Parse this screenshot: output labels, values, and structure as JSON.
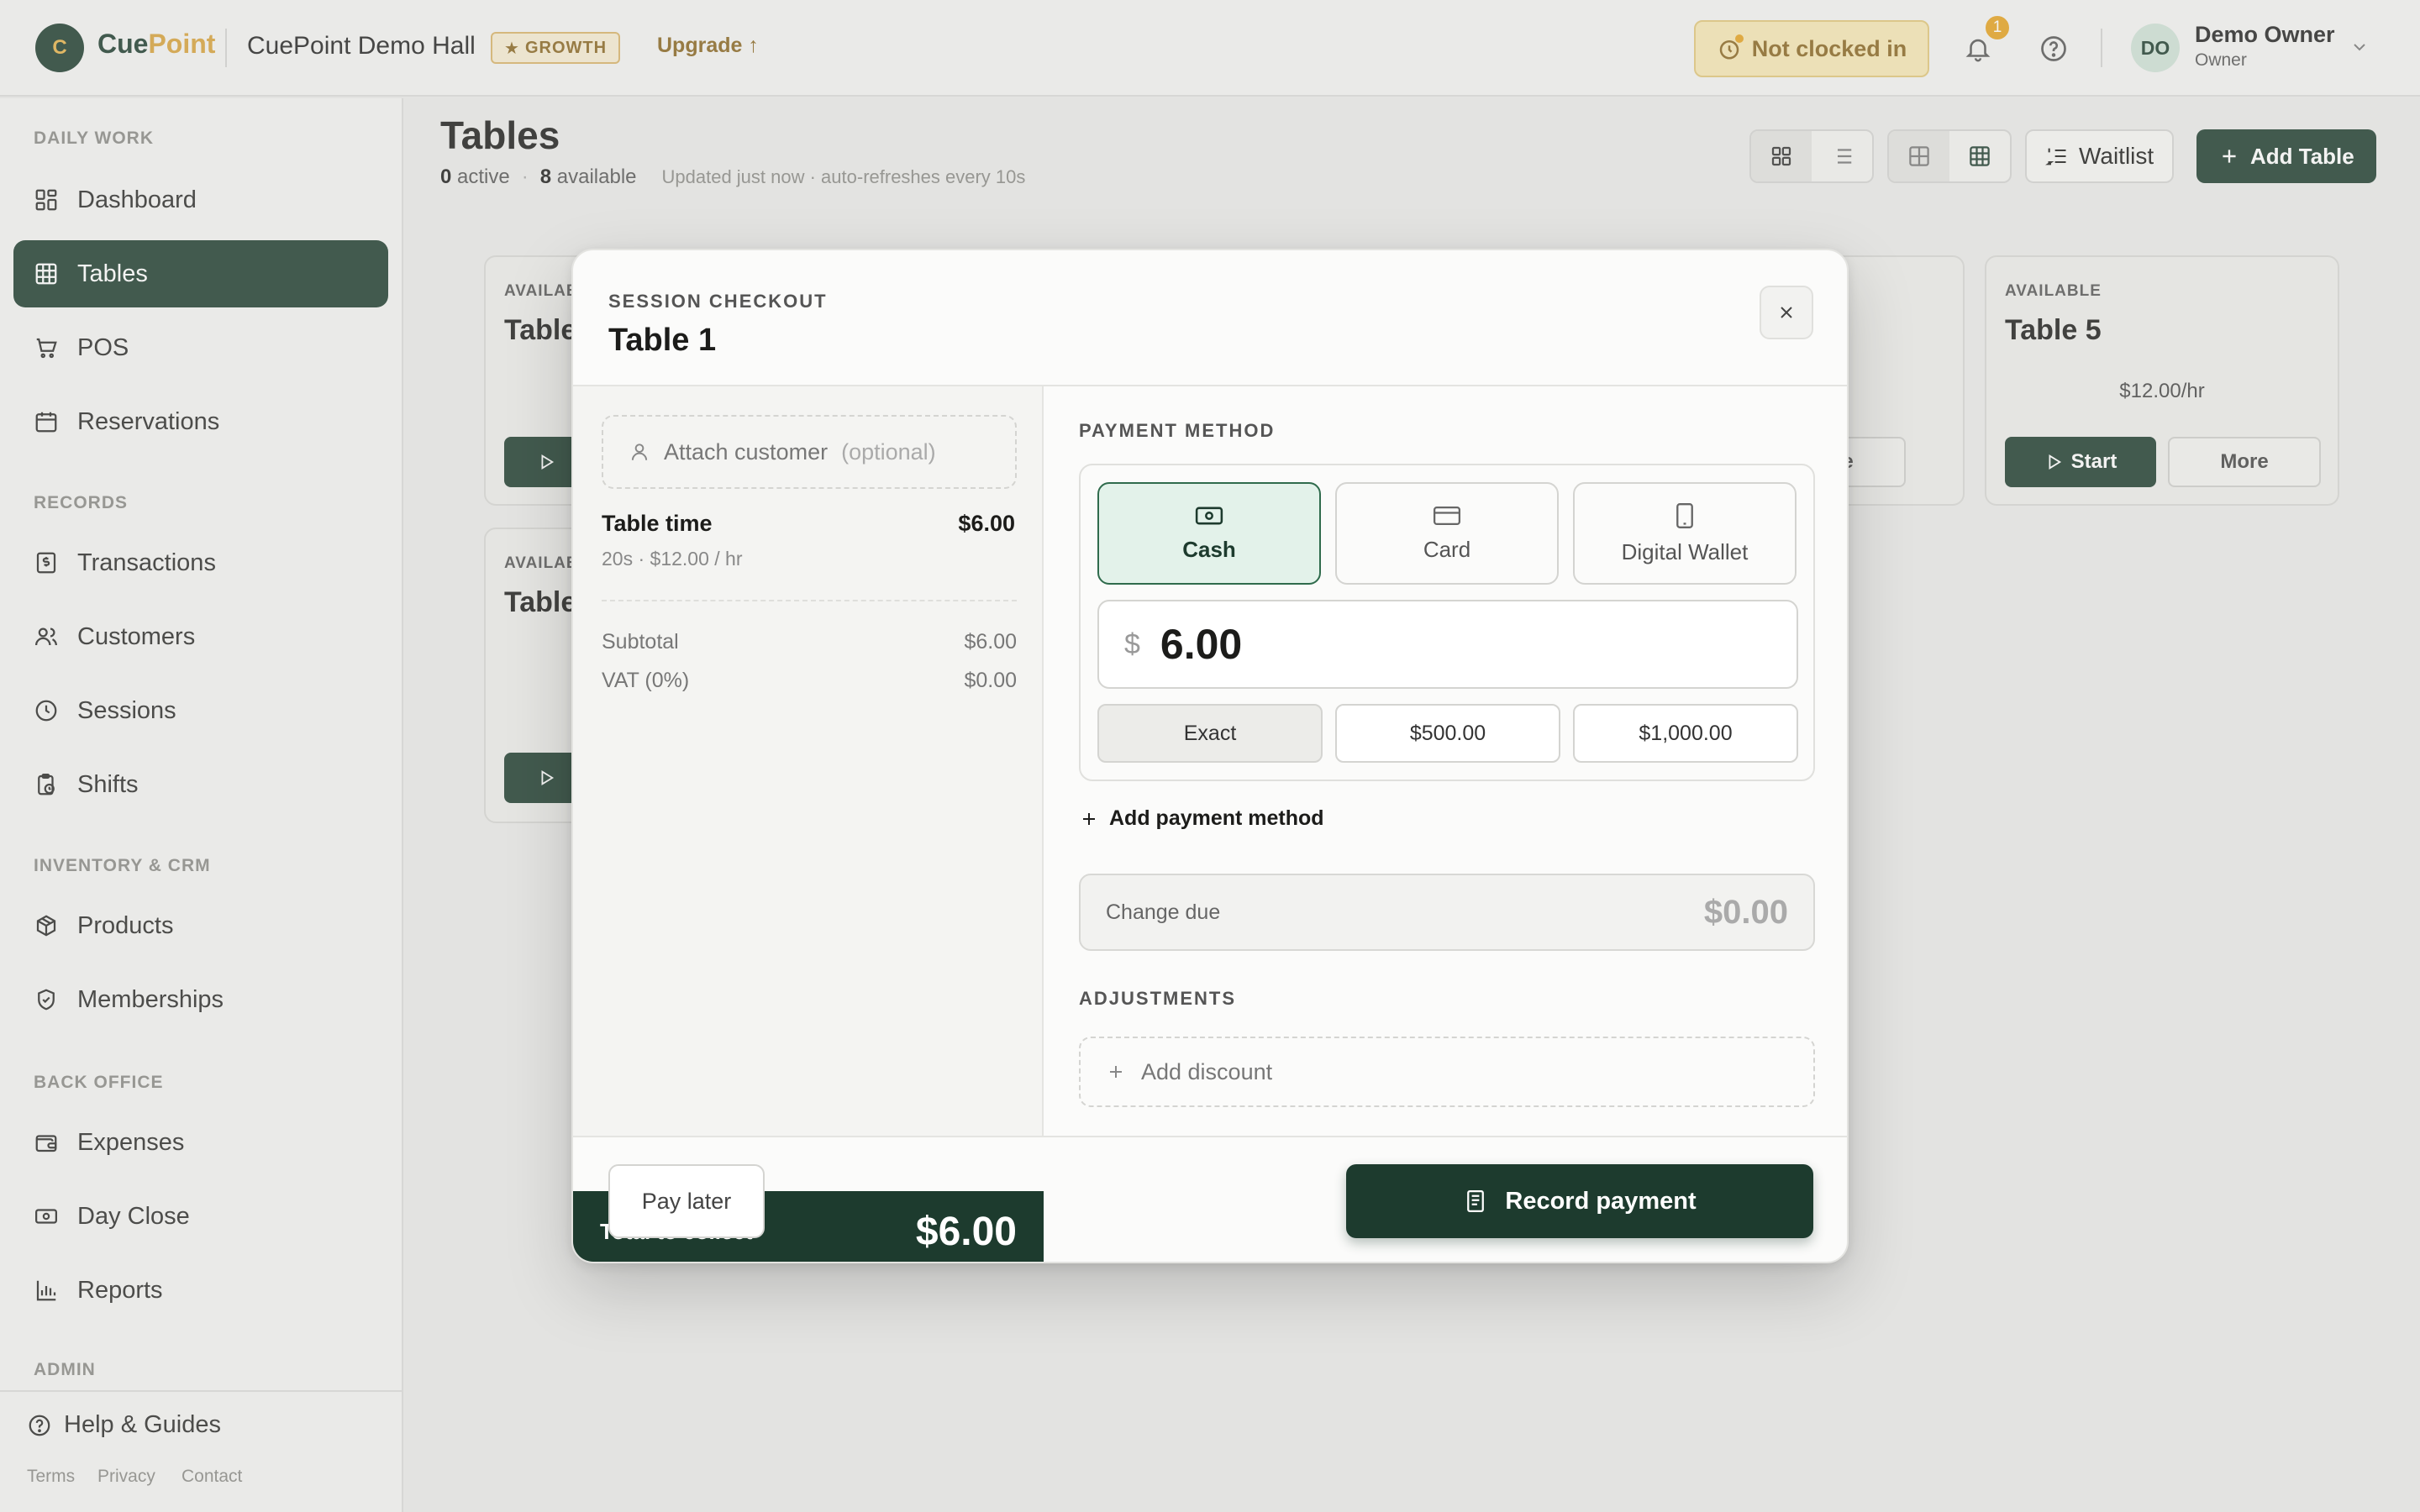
{
  "app": {
    "logo_letter": "C",
    "brand_part1": "Cue",
    "brand_part2": "Point",
    "venue": "CuePoint Demo Hall",
    "plan_badge": "GROWTH",
    "upgrade_label": "Upgrade ↑",
    "clock_status": "Not clocked in",
    "notification_count": "1",
    "user_initials": "DO",
    "user_name": "Demo Owner",
    "user_role": "Owner"
  },
  "sidebar": {
    "sections": [
      {
        "label": "DAILY WORK",
        "items": [
          {
            "label": "Dashboard",
            "icon": "dashboard-icon"
          },
          {
            "label": "Tables",
            "icon": "grid-icon",
            "active": true
          },
          {
            "label": "POS",
            "icon": "cart-icon"
          },
          {
            "label": "Reservations",
            "icon": "calendar-icon"
          }
        ]
      },
      {
        "label": "RECORDS",
        "items": [
          {
            "label": "Transactions",
            "icon": "receipt-dollar-icon"
          },
          {
            "label": "Customers",
            "icon": "users-icon"
          },
          {
            "label": "Sessions",
            "icon": "clock-icon"
          },
          {
            "label": "Shifts",
            "icon": "clipboard-clock-icon"
          }
        ]
      },
      {
        "label": "INVENTORY & CRM",
        "items": [
          {
            "label": "Products",
            "icon": "box-icon"
          },
          {
            "label": "Memberships",
            "icon": "shield-check-icon"
          }
        ]
      },
      {
        "label": "BACK OFFICE",
        "items": [
          {
            "label": "Expenses",
            "icon": "wallet-icon"
          },
          {
            "label": "Day Close",
            "icon": "banknote-icon"
          },
          {
            "label": "Reports",
            "icon": "bar-chart-icon"
          }
        ]
      },
      {
        "label": "ADMIN",
        "items": []
      }
    ],
    "help_label": "Help & Guides",
    "legal": [
      "Terms",
      "Privacy",
      "Contact"
    ]
  },
  "page": {
    "title": "Tables",
    "active_count": "0",
    "active_label": "active",
    "available_count": "8",
    "available_label": "available",
    "refresh_note": "Updated just now · auto-refreshes every 10s",
    "waitlist_label": "Waitlist",
    "add_table_label": "Add Table"
  },
  "cards": [
    {
      "status": "AVAILABLE",
      "name": "Table 5",
      "rate": "$12.00/hr",
      "start_label": "Start",
      "more_label": "More"
    },
    {
      "status": "AVAILABLE",
      "name": "Table",
      "rate": "",
      "start_label": "",
      "more_label": ""
    },
    {
      "status": "AVAILABLE",
      "name": "Table",
      "rate": "",
      "start_label": "",
      "more_label": ""
    },
    {
      "status": "",
      "name": "",
      "rate": "",
      "start_label": "",
      "more_label": "More"
    }
  ],
  "modal": {
    "eyebrow": "SESSION CHECKOUT",
    "title": "Table 1",
    "attach_label": "Attach customer",
    "attach_optional": "(optional)",
    "line_item": {
      "title": "Table time",
      "amount": "$6.00",
      "detail": "20s · $12.00 / hr"
    },
    "subtotal_label": "Subtotal",
    "subtotal_value": "$6.00",
    "vat_label": "VAT (0%)",
    "vat_value": "$0.00",
    "total_label": "Total to collect",
    "total_value": "$6.00",
    "payment_method_label": "PAYMENT METHOD",
    "methods": [
      {
        "label": "Cash",
        "icon": "cash-icon",
        "selected": true
      },
      {
        "label": "Card",
        "icon": "card-icon",
        "selected": false
      },
      {
        "label": "Digital Wallet",
        "icon": "phone-icon",
        "selected": false
      }
    ],
    "currency_symbol": "$",
    "amount_value": "6.00",
    "quick_amounts": [
      "Exact",
      "$500.00",
      "$1,000.00"
    ],
    "add_method_label": "Add payment method",
    "change_due_label": "Change due",
    "change_due_value": "$0.00",
    "adjustments_label": "ADJUSTMENTS",
    "add_discount_label": "Add discount",
    "pay_later_label": "Pay later",
    "record_label": "Record payment"
  },
  "colors": {
    "brand_green": "#1d3b2e",
    "accent_gold": "#d8a23a",
    "selected_method_bg": "#e3f2ea"
  }
}
